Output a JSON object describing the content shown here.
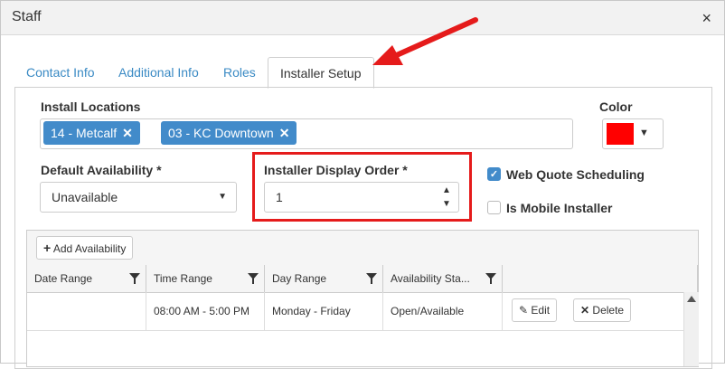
{
  "dialog": {
    "title": "Staff",
    "close": "×"
  },
  "tabs": [
    {
      "label": "Contact Info"
    },
    {
      "label": "Additional Info"
    },
    {
      "label": "Roles"
    },
    {
      "label": "Installer Setup"
    }
  ],
  "install_locations": {
    "label": "Install Locations",
    "chips": [
      {
        "label": "14 - Metcalf"
      },
      {
        "label": "03 - KC Downtown"
      }
    ]
  },
  "color": {
    "label": "Color",
    "value": "#ff0000"
  },
  "default_availability": {
    "label": "Default Availability *",
    "value": "Unavailable"
  },
  "installer_display_order": {
    "label": "Installer Display Order *",
    "value": "1"
  },
  "web_quote_scheduling": {
    "label": "Web Quote Scheduling",
    "checked": true
  },
  "is_mobile_installer": {
    "label": "Is Mobile Installer",
    "checked": false
  },
  "grid": {
    "add_button": "Add Availability",
    "columns": [
      "Date Range",
      "Time Range",
      "Day Range",
      "Availability Sta..."
    ],
    "rows": [
      {
        "date_range": "",
        "time_range": "08:00 AM - 5:00 PM",
        "day_range": "Monday - Friday",
        "status": "Open/Available"
      }
    ],
    "edit_label": "Edit",
    "delete_label": "Delete"
  }
}
